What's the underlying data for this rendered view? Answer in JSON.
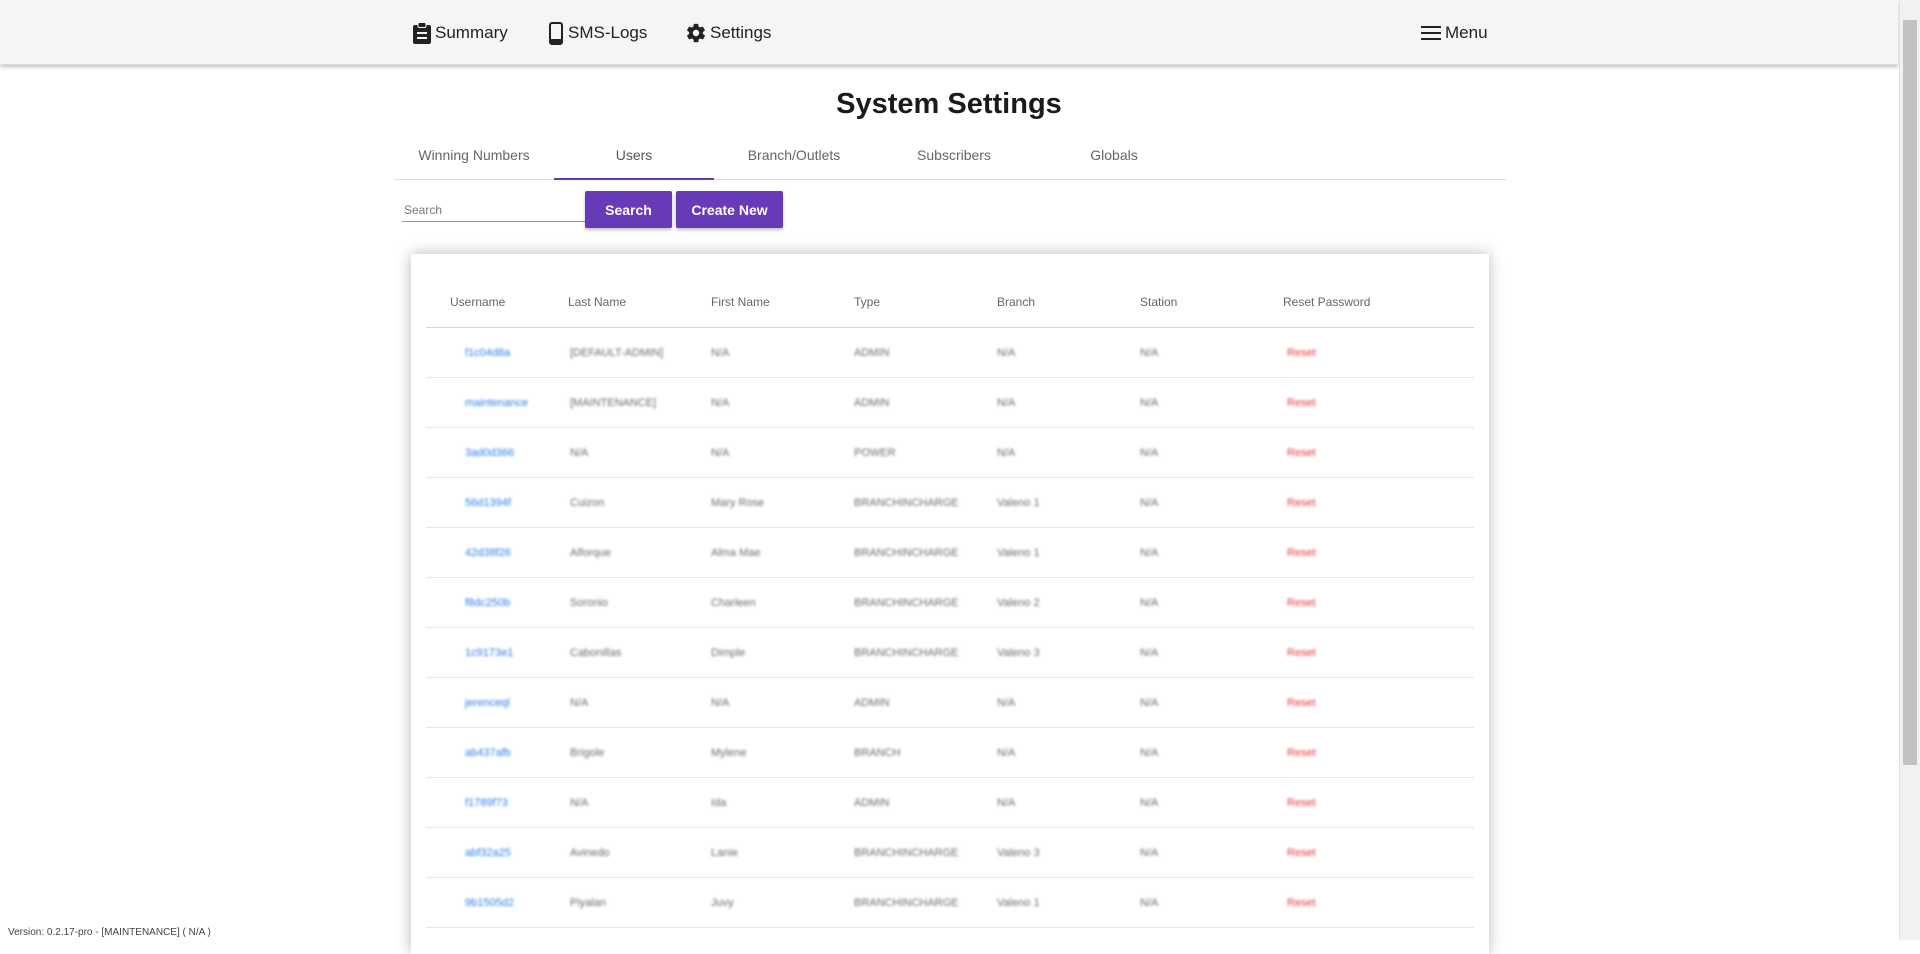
{
  "nav": {
    "summary_label": "Summary",
    "smslogs_label": "SMS-Logs",
    "settings_label": "Settings",
    "menu_label": "Menu"
  },
  "page": {
    "title": "System Settings"
  },
  "tabs": [
    {
      "label": "Winning Numbers"
    },
    {
      "label": "Users"
    },
    {
      "label": "Branch/Outlets"
    },
    {
      "label": "Subscribers"
    },
    {
      "label": "Globals"
    }
  ],
  "active_tab": "Users",
  "search": {
    "placeholder": "Search",
    "value": "",
    "search_button": "Search",
    "create_button": "Create New"
  },
  "table": {
    "headers": [
      "Username",
      "Last Name",
      "First Name",
      "Type",
      "Branch",
      "Station",
      "Reset Password"
    ],
    "rows": [
      {
        "username": "f1c04d8a",
        "last_name": "[DEFAULT-ADMIN]",
        "first_name": "N/A",
        "type": "ADMIN",
        "branch": "N/A",
        "station": "N/A",
        "reset": "Reset"
      },
      {
        "username": "maintenance",
        "last_name": "[MAINTENANCE]",
        "first_name": "N/A",
        "type": "ADMIN",
        "branch": "N/A",
        "station": "N/A",
        "reset": "Reset"
      },
      {
        "username": "3ad0d366",
        "last_name": "N/A",
        "first_name": "N/A",
        "type": "POWER",
        "branch": "N/A",
        "station": "N/A",
        "reset": "Reset"
      },
      {
        "username": "56d1394f",
        "last_name": "Cuizon",
        "first_name": "Mary Rose",
        "type": "BRANCHINCHARGE",
        "branch": "Valeno 1",
        "station": "N/A",
        "reset": "Reset"
      },
      {
        "username": "42d38f26",
        "last_name": "Alforque",
        "first_name": "Alma Mae",
        "type": "BRANCHINCHARGE",
        "branch": "Valeno 1",
        "station": "N/A",
        "reset": "Reset"
      },
      {
        "username": "f8dc250b",
        "last_name": "Soronio",
        "first_name": "Charleen",
        "type": "BRANCHINCHARGE",
        "branch": "Valeno 2",
        "station": "N/A",
        "reset": "Reset"
      },
      {
        "username": "1c9173e1",
        "last_name": "Cabonillas",
        "first_name": "Dimple",
        "type": "BRANCHINCHARGE",
        "branch": "Valeno 3",
        "station": "N/A",
        "reset": "Reset"
      },
      {
        "username": "jerenceql",
        "last_name": "N/A",
        "first_name": "N/A",
        "type": "ADMIN",
        "branch": "N/A",
        "station": "N/A",
        "reset": "Reset"
      },
      {
        "username": "ab437afb",
        "last_name": "Brigole",
        "first_name": "Mylene",
        "type": "BRANCH",
        "branch": "N/A",
        "station": "N/A",
        "reset": "Reset"
      },
      {
        "username": "f1789f73",
        "last_name": "N/A",
        "first_name": "Ida",
        "type": "ADMIN",
        "branch": "N/A",
        "station": "N/A",
        "reset": "Reset"
      },
      {
        "username": "abf32a25",
        "last_name": "Avinedo",
        "first_name": "Lanie",
        "type": "BRANCHINCHARGE",
        "branch": "Valeno 3",
        "station": "N/A",
        "reset": "Reset"
      },
      {
        "username": "9b1505d2",
        "last_name": "Piyalan",
        "first_name": "Juvy",
        "type": "BRANCHINCHARGE",
        "branch": "Valeno 1",
        "station": "N/A",
        "reset": "Reset"
      }
    ]
  },
  "footer": {
    "version": "Version: 0.2.17-pro - [MAINTENANCE] ( N/A )"
  },
  "colors": {
    "accent": "#673ab7",
    "link": "#2b7de9",
    "danger": "#e53935"
  }
}
